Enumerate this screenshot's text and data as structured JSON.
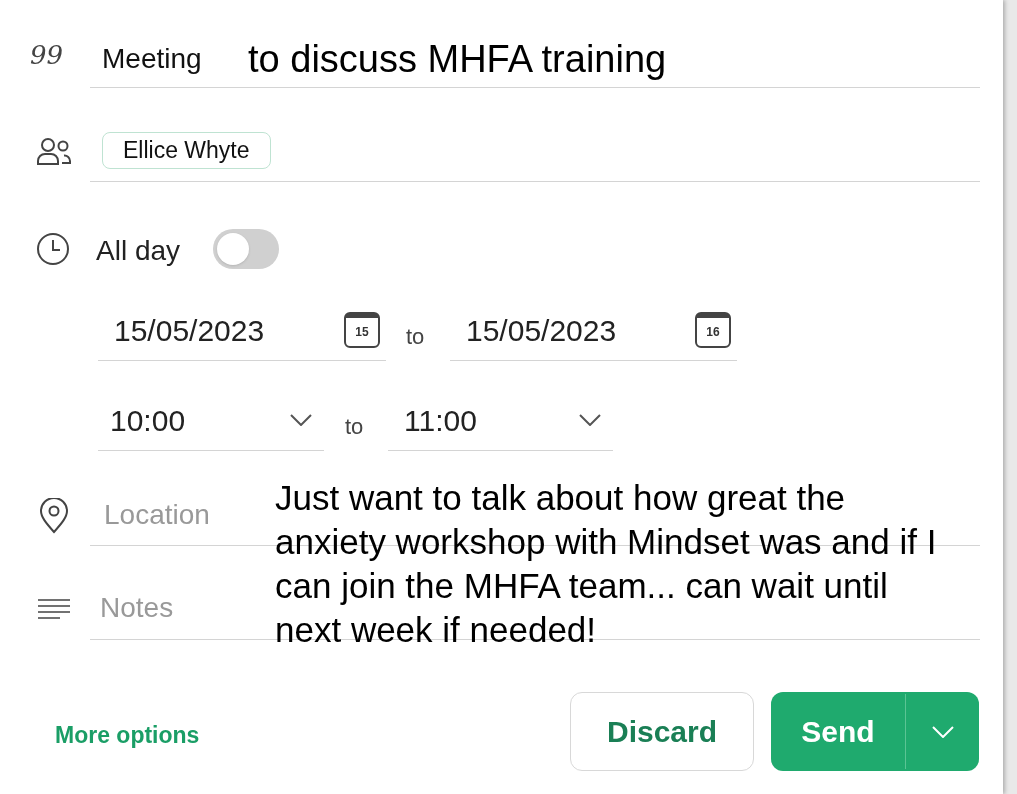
{
  "title": {
    "icon": "99",
    "value": "Meeting",
    "overlay": "to discuss MHFA training"
  },
  "attendees": [
    {
      "name": "Ellice Whyte"
    }
  ],
  "all_day": {
    "label": "All day",
    "on": false
  },
  "dates": {
    "start": {
      "value": "15/05/2023",
      "calendar_day": "15"
    },
    "separator": "to",
    "end": {
      "value": "15/05/2023",
      "calendar_day": "16"
    }
  },
  "times": {
    "start": "10:00",
    "separator": "to",
    "end": "11:00"
  },
  "location": {
    "placeholder": "Location"
  },
  "notes": {
    "placeholder": "Notes",
    "overlay": "Just want to talk about how great the anxiety workshop with Mindset was and if I can join the MHFA team... can wait until next week if needed!"
  },
  "footer": {
    "more_options": "More options",
    "discard": "Discard",
    "send": "Send"
  }
}
